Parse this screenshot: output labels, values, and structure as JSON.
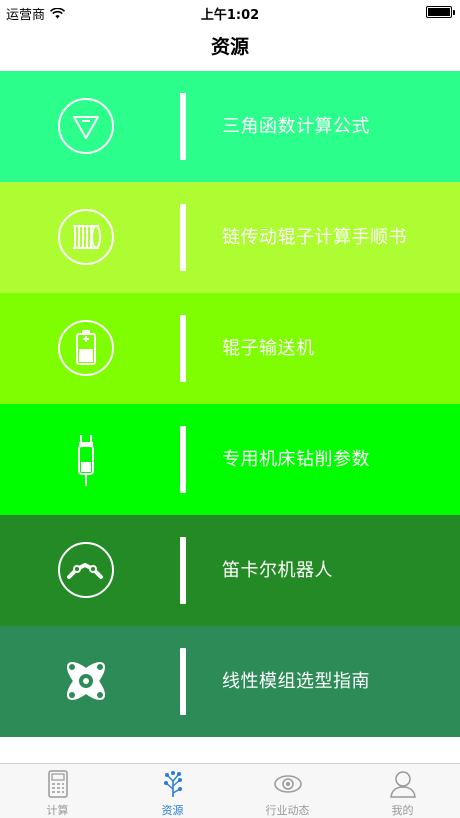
{
  "status": {
    "carrier": "运营商",
    "time": "上午1:02"
  },
  "navbar": {
    "title": "资源"
  },
  "resources": [
    {
      "label": "三角函数计算公式",
      "color": "#2CFE8C",
      "icon": "triangle-icon"
    },
    {
      "label": "链传动辊子计算手顺书",
      "color": "#ADFD32",
      "icon": "chain-roller-icon"
    },
    {
      "label": "辊子输送机",
      "color": "#7FFE01",
      "icon": "battery-roller-icon"
    },
    {
      "label": "专用机床钻削参数",
      "color": "#00FE00",
      "icon": "drill-bit-icon"
    },
    {
      "label": "笛卡尔机器人",
      "color": "#248A25",
      "icon": "robot-arm-icon"
    },
    {
      "label": "线性模组选型指南",
      "color": "#2D8B57",
      "icon": "linear-module-icon"
    }
  ],
  "tabs": [
    {
      "label": "计算",
      "icon": "calculator-icon",
      "active": false
    },
    {
      "label": "资源",
      "icon": "resource-tree-icon",
      "active": true
    },
    {
      "label": "行业动态",
      "icon": "eye-icon",
      "active": false
    },
    {
      "label": "我的",
      "icon": "user-icon",
      "active": false
    }
  ],
  "colors": {
    "tab_active": "#2A7FD4",
    "tab_inactive": "#999999"
  }
}
